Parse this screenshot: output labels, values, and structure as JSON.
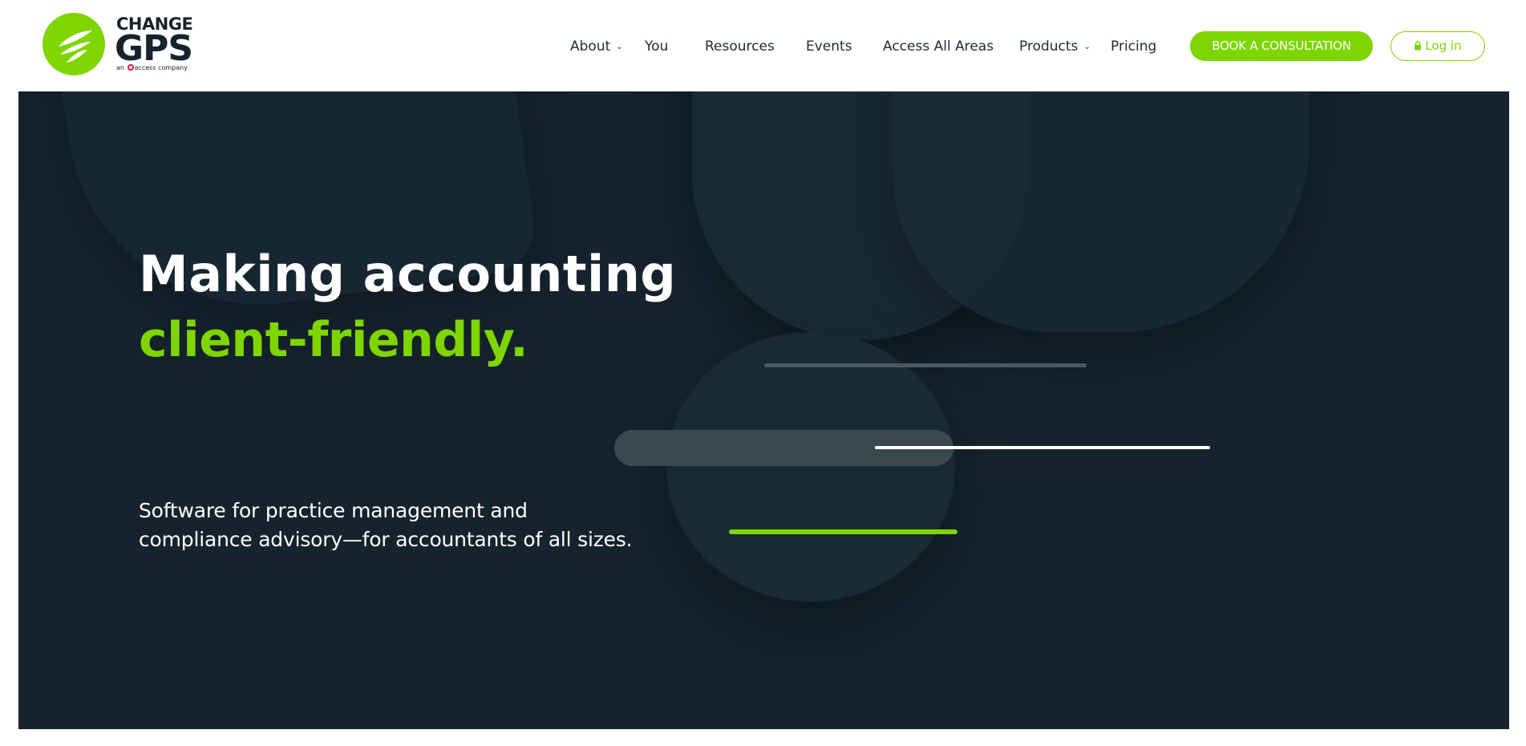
{
  "brand": {
    "name_top": "CHANGE",
    "name_main": "GPS",
    "tagline_prefix": "an",
    "tagline_brand": "access",
    "tagline_suffix": "company",
    "accent_color": "#7ed500",
    "dark_color": "#15232d"
  },
  "nav": {
    "items": [
      {
        "label": "About",
        "has_dropdown": true
      },
      {
        "label": "You",
        "has_dropdown": false
      },
      {
        "label": "Resources",
        "has_dropdown": false
      },
      {
        "label": "Events",
        "has_dropdown": false
      },
      {
        "label": "Access All Areas",
        "has_dropdown": false
      },
      {
        "label": "Products",
        "has_dropdown": true
      },
      {
        "label": "Pricing",
        "has_dropdown": false
      }
    ],
    "dropdown_icon": "chevron-down-icon"
  },
  "cta": {
    "consult_label": "BOOK A CONSULTATION",
    "login_label": "Log in",
    "login_icon": "lock-icon"
  },
  "hero": {
    "headline_line1": "Making accounting",
    "headline_line2": "client-friendly.",
    "subtext_line1": "Software for practice management and",
    "subtext_line2": "compliance advisory—for accountants of all sizes.",
    "background_color": "#15232d"
  }
}
